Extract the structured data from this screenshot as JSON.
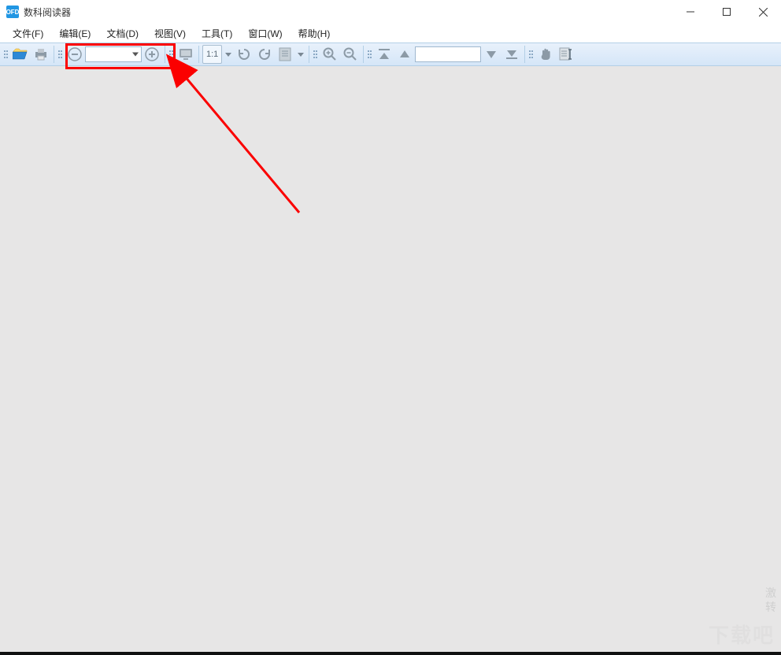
{
  "title": "数科阅读器",
  "app_icon_label": "OFD",
  "menu": {
    "file": "文件(F)",
    "edit": "编辑(E)",
    "doc": "文档(D)",
    "view": "视图(V)",
    "tool": "工具(T)",
    "window": "窗口(W)",
    "help": "帮助(H)"
  },
  "toolbar": {
    "zoom_value": "",
    "ratio_label": "1:1",
    "page_value": ""
  },
  "watermark": {
    "line1": "激",
    "line2": "转"
  },
  "watermark_logo": "下载吧"
}
